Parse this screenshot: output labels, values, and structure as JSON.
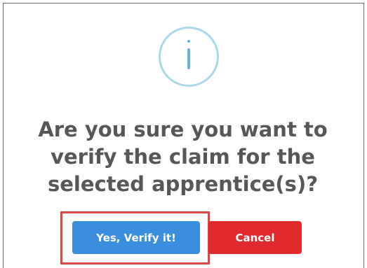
{
  "dialog": {
    "icon": "info-icon",
    "title": "Are you sure you want to verify the claim for the selected apprentice(s)?",
    "confirm_label": "Yes, Verify it!",
    "cancel_label": "Cancel"
  },
  "colors": {
    "info_icon_ring": "#a8d8ea",
    "info_icon_glyph": "#62b3d8",
    "confirm_button": "#3b8ede",
    "cancel_button": "#e02a2e",
    "highlight_outline": "#e04848",
    "title_text": "#575757"
  }
}
